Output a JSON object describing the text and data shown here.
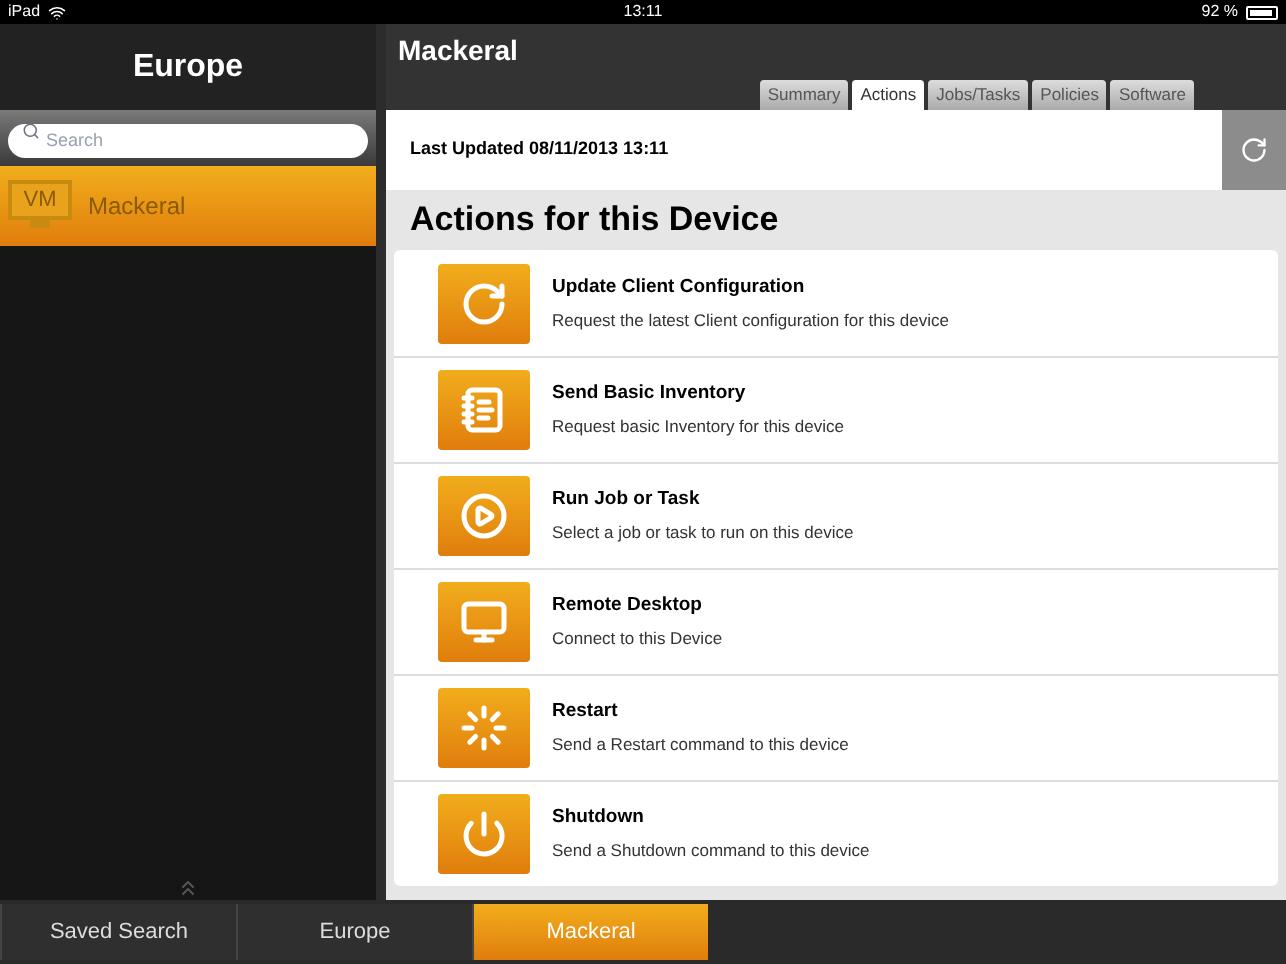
{
  "status_bar": {
    "device": "iPad",
    "time": "13:11",
    "battery": "92 %"
  },
  "sidebar": {
    "title": "Europe",
    "search": {
      "placeholder": "Search"
    },
    "items": [
      {
        "icon_label": "VM",
        "name": "Mackeral",
        "selected": true
      }
    ]
  },
  "device": {
    "title": "Mackeral",
    "tabs": [
      {
        "label": "Summary",
        "selected": false
      },
      {
        "label": "Actions",
        "selected": true
      },
      {
        "label": "Jobs/Tasks",
        "selected": false
      },
      {
        "label": "Policies",
        "selected": false
      },
      {
        "label": "Software",
        "selected": false
      }
    ],
    "last_updated": "Last Updated 08/11/2013 13:11"
  },
  "actions_title": "Actions for this Device",
  "actions": [
    {
      "kind": "refresh",
      "title": "Update Client Configuration",
      "description": "Request the latest Client configuration for this device"
    },
    {
      "kind": "inventory",
      "title": "Send Basic Inventory",
      "description": "Request basic Inventory for this device"
    },
    {
      "kind": "run",
      "title": "Run Job or Task",
      "description": "Select a job or task to run on this device"
    },
    {
      "kind": "remote",
      "title": "Remote Desktop",
      "description": "Connect to this Device"
    },
    {
      "kind": "restart",
      "title": "Restart",
      "description": "Send a Restart command to this device"
    },
    {
      "kind": "shutdown",
      "title": "Shutdown",
      "description": "Send a Shutdown command to this device"
    }
  ],
  "breadcrumbs": [
    {
      "label": "Saved Search",
      "selected": false
    },
    {
      "label": "Europe",
      "selected": false
    },
    {
      "label": "Mackeral",
      "selected": true
    }
  ]
}
